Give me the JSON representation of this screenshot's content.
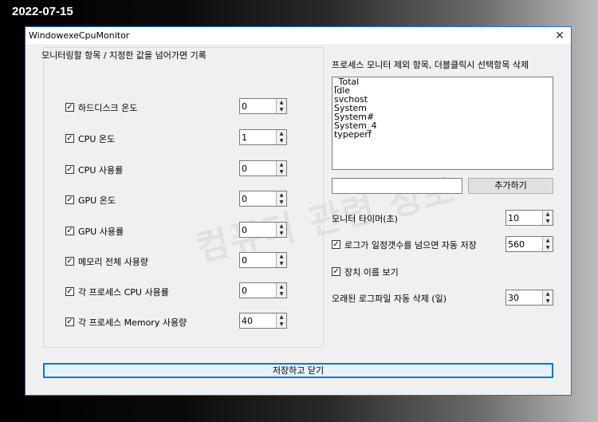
{
  "overlay_date": "2022-07-15",
  "window": {
    "title": "WindowexeCpuMonitor",
    "close_glyph": "✕"
  },
  "watermark": "컴퓨터 관련 정보",
  "left_group": {
    "header": "모니터링할 항목 / 지정한 값을 넘어가면 기록",
    "items": [
      {
        "label": "하드디스크 온도",
        "checked": true,
        "value": "0"
      },
      {
        "label": "CPU 온도",
        "checked": true,
        "value": "1"
      },
      {
        "label": "CPU 사용률",
        "checked": true,
        "value": "0"
      },
      {
        "label": "GPU 온도",
        "checked": true,
        "value": "0"
      },
      {
        "label": "GPU 사용률",
        "checked": true,
        "value": "0"
      },
      {
        "label": "메모리 전체 사용량",
        "checked": true,
        "value": "0"
      },
      {
        "label": "각 프로세스 CPU 사용률",
        "checked": true,
        "value": "0"
      },
      {
        "label": "각 프로세스 Memory 사용량",
        "checked": true,
        "value": "40"
      }
    ]
  },
  "right": {
    "exclude_header": "프로세스 모니터 제외 항목, 더블클릭시 선택항목 삭제",
    "exclude_list": [
      "_Total",
      "Idle",
      "svchost",
      "System",
      "System#",
      "System_4",
      "typeperf"
    ],
    "add_input_value": "",
    "add_button": "추가하기",
    "timer_label": "모니터 타이머(초)",
    "timer_value": "10",
    "autosave_label": "로그가 일정갯수를 넘으면 자동 저장",
    "autosave_checked": true,
    "autosave_value": "560",
    "device_name_label": "장치 이름 보기",
    "device_name_checked": true,
    "old_log_label": "오래된 로그파일 자동 삭제 (일)",
    "old_log_value": "30"
  },
  "save_button": "저장하고 닫기"
}
